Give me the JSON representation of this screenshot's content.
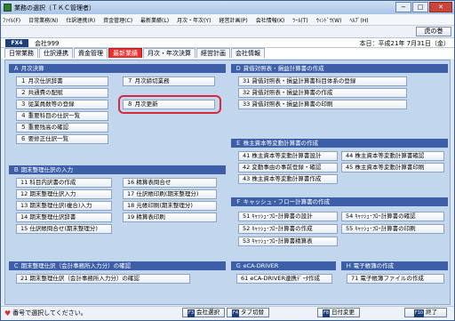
{
  "window": {
    "title": "業務の選択（ＴＫＣ管理者）",
    "min": "−",
    "max": "□",
    "close": "✕"
  },
  "menubar": [
    "ﾌｧｲﾙ(F)",
    "日常業務(N)",
    "仕訳連携(R)",
    "資金管理(C)",
    "最新業績(L)",
    "月次・年次(Y)",
    "経営計画(P)",
    "会社情報(K)",
    "ﾂｰﾙ(T)",
    "ｳｨﾝﾄﾞｳ(W)",
    "ﾍﾙﾌﾟ(H)"
  ],
  "toolbar": {
    "back_label": "虎の巻"
  },
  "info": {
    "fx4": "FX4",
    "company": "会社999",
    "date": "本日：平成21年 7月31日（金）"
  },
  "tabs": [
    "日常業務",
    "仕訳連携",
    "資金管理",
    "最新業績",
    "月次・年次決算",
    "経営計画",
    "会社情報"
  ],
  "active_tab": "最新業績",
  "sections": {
    "A": {
      "title": "Ａ 月次決算",
      "items": [
        "１ 月次仕訳辞書",
        "２ 共通費の配賦",
        "３ 従業員数等の登録",
        "４ 重要科目の仕訳一覧",
        "５ 重要残高の確認",
        "６ 要修正仕訳一覧",
        "７ 月次締切業務",
        "８ 月次更新"
      ]
    },
    "B": {
      "title": "Ｂ 期末整理仕訳の入力",
      "items": [
        "11 科目内訳書の作成",
        "12 期末整理仕訳入力",
        "13 期末整理仕訳(複合)入力",
        "14 期末整理仕訳辞書",
        "15 仕訳帳問合せ(期末整理分)",
        "16 精算表問合せ",
        "17 仕訳帳印刷(期末整理分)",
        "18 元帳印刷(期末整理分)",
        "19 精算表印刷"
      ]
    },
    "C": {
      "title": "Ｃ 期末整理仕訳（会計事務所入力分）の確認",
      "items": [
        "21 期末整理仕訳（会計事務所入力分）の確認"
      ]
    },
    "D": {
      "title": "Ｄ 貸借対照表・損益計算書の作成",
      "items": [
        "31 貸借対照表・損益計算書科目体系の登録",
        "32 貸借対照表・損益計算書の作成",
        "33 貸借対照表・損益計算書の印刷"
      ]
    },
    "E": {
      "title": "Ｅ 株主資本等変動計算書の作成",
      "items": [
        "41 株主資本等変動計算書設計",
        "42 変動事由の事前登録・確認",
        "43 株主資本等変動計算書作成",
        "44 株主資本等変動計算書確認",
        "45 株主資本等変動計算書印刷"
      ]
    },
    "F": {
      "title": "Ｆ キャッシュ・フロー計算書の作成",
      "items": [
        "51 ｷｬｯｼｭ･ﾌﾛｰ計算書の設計",
        "52 ｷｬｯｼｭ･ﾌﾛｰ計算書の作成",
        "53 ｷｬｯｼｭ･ﾌﾛｰ計算書精算表",
        "54 ｷｬｯｼｭ･ﾌﾛｰ計算書の確認",
        "55 ｷｬｯｼｭ･ﾌﾛｰ計算書の印刷"
      ]
    },
    "G": {
      "title": "Ｇ eCA-DRIVER",
      "items": [
        "61 eCA-DRIVER連携ﾃﾞｰﾀ作成"
      ]
    },
    "H": {
      "title": "Ｈ 電子帳簿の作成",
      "items": [
        "71 電子帳簿ファイルの作成"
      ]
    }
  },
  "status": {
    "heart": "♥",
    "message": "番号で選択してください。"
  },
  "fkeys": [
    {
      "key": "F3",
      "label": "会社選択"
    },
    {
      "key": "F4",
      "label": "タブ切替"
    },
    {
      "key": "F8",
      "label": "日付変更"
    },
    {
      "key": "F10",
      "label": "終了"
    }
  ],
  "colors": {
    "panel_header": "#3d5fa8",
    "active_tab": "#e8302c",
    "highlight": "#d62a3a",
    "content_bg": "#c2d7ee"
  }
}
